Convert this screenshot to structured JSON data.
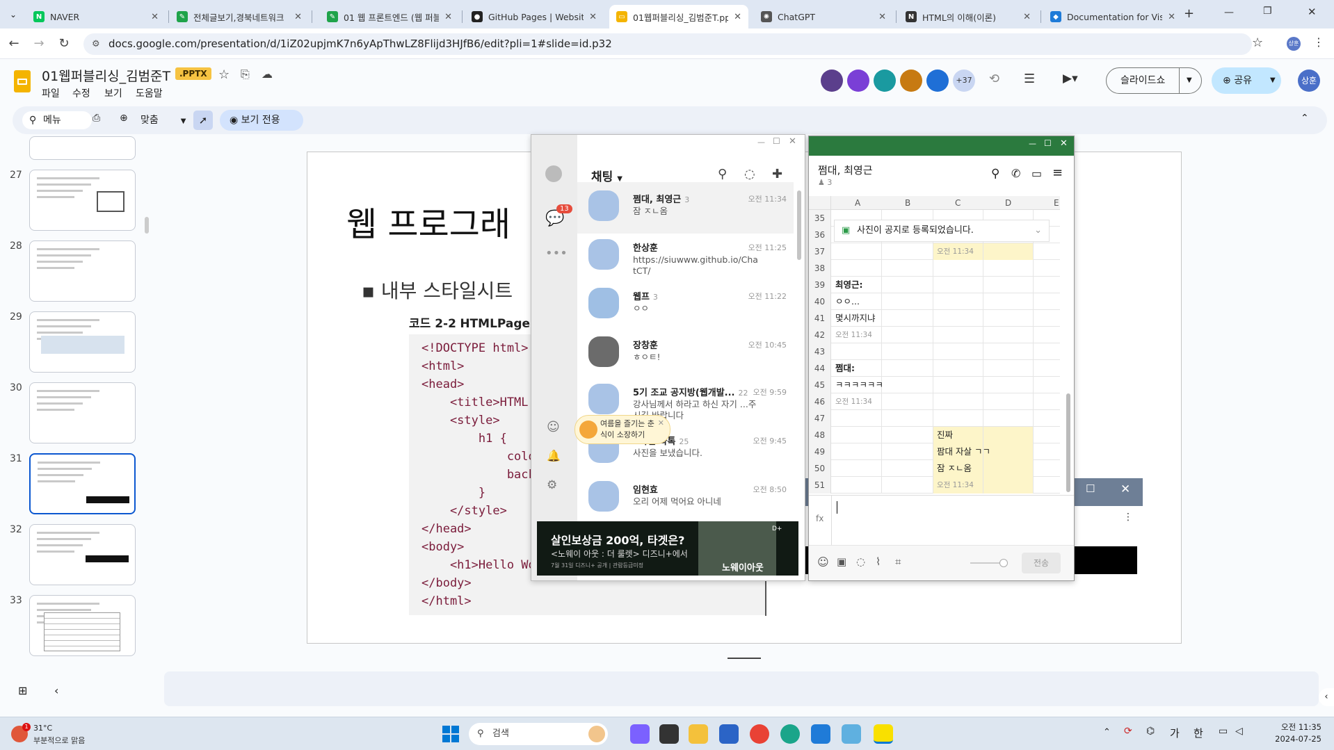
{
  "browser": {
    "tabs": [
      {
        "label": "NAVER",
        "color": "#03c75a",
        "glyph": "N"
      },
      {
        "label": "전체글보기,경북네트워크",
        "color": "#1fa34a",
        "glyph": "✎"
      },
      {
        "label": "01 웹 프론트엔드 (웹 퍼블",
        "color": "#1fa34a",
        "glyph": "✎"
      },
      {
        "label": "GitHub Pages | Websites",
        "color": "#222",
        "glyph": "●"
      },
      {
        "label": "01웹퍼블리싱_김범준T.pp",
        "color": "#f4b400",
        "glyph": "▭"
      },
      {
        "label": "ChatGPT",
        "color": "#555",
        "glyph": "✺"
      },
      {
        "label": "HTML의 이해(이론)",
        "color": "#333",
        "glyph": "N"
      },
      {
        "label": "Documentation for Visua",
        "color": "#1f7bd8",
        "glyph": "◆"
      }
    ],
    "url": "docs.google.com/presentation/d/1iZ02upjmK7n6yApThwLZ8Flijd3HJfB6/edit?pli=1#slide=id.p32"
  },
  "doc": {
    "title": "01웹퍼블리싱_김범준T",
    "ext": ".PPTX",
    "menus": [
      "파일",
      "수정",
      "보기",
      "도움말"
    ],
    "collab_count": "+37",
    "slideshow": "슬라이드쇼",
    "share": "공유",
    "user": "상훈"
  },
  "toolbar": {
    "menu": "메뉴",
    "zoom": "맞춤",
    "view_only": "보기 전용"
  },
  "slides": [
    "27",
    "28",
    "29",
    "30",
    "31",
    "32",
    "33"
  ],
  "slide": {
    "title": "웹 프로그래",
    "bullet": "내부 스타일시트",
    "caption_code": "코드 2-2",
    "caption_file": "HTMLPage",
    "code": [
      "<!DOCTYPE html>",
      "<html>",
      "<head>",
      "    <title>HTML",
      "    <style>",
      "        h1 {",
      "            colo",
      "            back",
      "        }",
      "    </style>",
      "</head>",
      "<body>",
      "    <h1>Hello Wo",
      "</body>",
      "</html>"
    ]
  },
  "kakao": {
    "header": "채팅",
    "badge": "13",
    "ad_banner": "여름을 즐기는 춘식이 소장하기",
    "ad_title": "살인보상금 200억, 타겟은?",
    "ad_sub": "<노웨이 아웃 : 더 룰렛> 디즈니+에서",
    "ad_fine": "7월 31일 디즈니+ 공개 | 관람등급미정",
    "ad_logo": "노웨이아웃",
    "chats": [
      {
        "name": "쩜대, 최영근",
        "count": "3",
        "msg": "잠 ㅈㄴ옴",
        "time": "오전 11:34"
      },
      {
        "name": "한상훈",
        "count": "",
        "msg": "https://siuwww.github.io/ChatCT/",
        "time": "오전 11:25"
      },
      {
        "name": "웹프",
        "count": "3",
        "msg": "ㅇㅇ",
        "time": "오전 11:22"
      },
      {
        "name": "장창훈",
        "count": "",
        "msg": "ㅎㅇㅌ!",
        "time": "오전 10:45"
      },
      {
        "name": "5기 조교 공지방(웹개발...",
        "count": "22",
        "msg": "강사님께서 하라고 하신 자기 ...주시길 바랍니다",
        "time": "오전 9:59"
      },
      {
        "name": "3학년 과톡",
        "count": "25",
        "msg": "사진을 보냈습니다.",
        "time": "오전 9:45"
      },
      {
        "name": "임현효",
        "count": "",
        "msg": "오리 어제 먹어요 아니네",
        "time": "오전 8:50"
      }
    ]
  },
  "chatroom": {
    "title": "쩜대, 최영근",
    "members": "3",
    "notice": "사진이 공지로 등록되었습니다.",
    "send": "전송",
    "fx": "fx",
    "cols": [
      "A",
      "B",
      "C",
      "D",
      "E"
    ],
    "rows": [
      {
        "n": "35",
        "t": "",
        "k": ""
      },
      {
        "n": "36",
        "t": "",
        "k": ""
      },
      {
        "n": "37",
        "t": "",
        "k": "right-time",
        "v": "오전 11:34"
      },
      {
        "n": "38",
        "t": "",
        "k": ""
      },
      {
        "n": "39",
        "t": "최영근:",
        "k": "name"
      },
      {
        "n": "40",
        "t": "ㅇㅇ...",
        "k": "left"
      },
      {
        "n": "41",
        "t": "몇시까지냐",
        "k": "left"
      },
      {
        "n": "42",
        "t": "",
        "k": "left-time",
        "v": "오전 11:34"
      },
      {
        "n": "43",
        "t": "",
        "k": ""
      },
      {
        "n": "44",
        "t": "쩜대:",
        "k": "name"
      },
      {
        "n": "45",
        "t": "ㅋㅋㅋㅋㅋㅋ",
        "k": "left"
      },
      {
        "n": "46",
        "t": "",
        "k": "left-time",
        "v": "오전 11:34"
      },
      {
        "n": "47",
        "t": "",
        "k": ""
      },
      {
        "n": "48",
        "t": "진짜",
        "k": "right"
      },
      {
        "n": "49",
        "t": "팜대 자살 ㄱㄱ",
        "k": "right"
      },
      {
        "n": "50",
        "t": "잠 ㅈㄴ옴",
        "k": "right"
      },
      {
        "n": "51",
        "t": "",
        "k": "right-time",
        "v": "오전 11:34"
      }
    ]
  },
  "taskbar": {
    "temp": "31°C",
    "weather": "부분적으로 맑음",
    "search": "검색",
    "time": "오전 11:35",
    "date": "2024-07-25",
    "ime1": "가",
    "ime2": "한"
  }
}
